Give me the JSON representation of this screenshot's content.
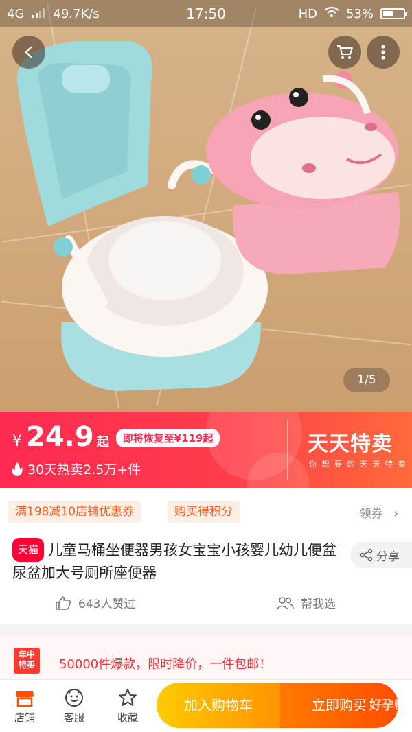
{
  "status_bar": {
    "network": "4G",
    "speed": "49.7K/s",
    "time": "17:50",
    "hd": "HD",
    "battery": "53%",
    "battery_level": 0.53
  },
  "gallery": {
    "counter": "1/5"
  },
  "promo": {
    "currency": "¥",
    "price": "24.9",
    "price_suffix": "起",
    "restore_note": "即将恢复至¥119起",
    "sales": "30天热卖2.5万+件",
    "brand": "天天特卖",
    "slogan": "你 想 要 的   天 天 特 卖"
  },
  "coupons": {
    "shop_coupon": "满198减10店铺优惠券",
    "points": "购买得积分",
    "get_coupon": "领券"
  },
  "product": {
    "tmall_badge": "天猫",
    "title": "儿童马桶坐便器男孩女宝宝小孩婴儿幼儿便盆尿盆加大号厕所座便器",
    "share": "分享",
    "likes": "643人赞过",
    "help_choose": "帮我选"
  },
  "activity": {
    "badge_line1": "年中",
    "badge_line2": "特卖",
    "text": "50000件爆款，限时降价，一件包邮！"
  },
  "bottom_bar": {
    "shop": "店铺",
    "service": "客服",
    "favorite": "收藏",
    "add_to_cart": "加入购物车",
    "buy_now": "立即购买"
  },
  "watermark": "好孕帮"
}
